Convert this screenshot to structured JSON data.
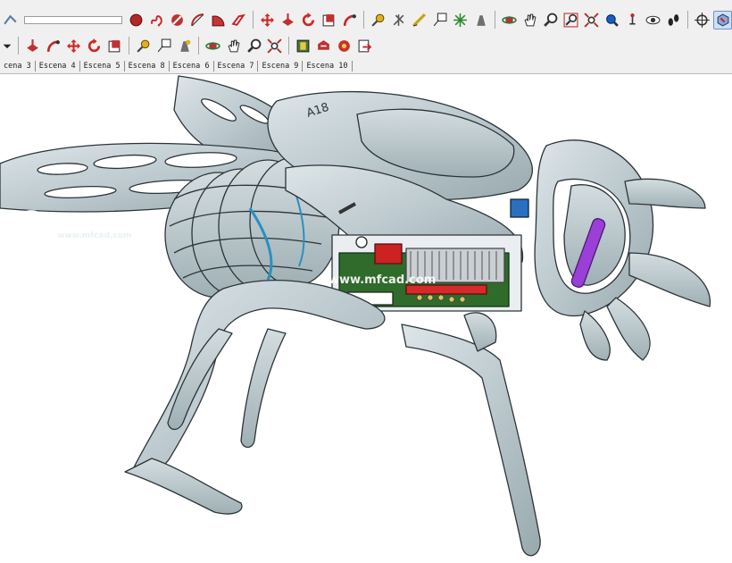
{
  "scene_tabs": [
    "cena 3",
    "Escena 4",
    "Escena 5",
    "Escena 8",
    "Escena 6",
    "Escena 7",
    "Escena 9",
    "Escena 10"
  ],
  "watermark": {
    "brand_cn": "沐风网",
    "url_small": "www.mfcad.com",
    "url_center": "www.mfcad.com"
  },
  "model_label": "A18",
  "toolbar_row1_icons": [
    "partial-icon",
    "circle-icon",
    "freehand-icon",
    "no-icon",
    "protractor-icon",
    "pie-icon",
    "curve-icon",
    "move-icon",
    "push-pull-icon",
    "rotate-icon",
    "scale-icon",
    "follow-me-icon",
    "tape-measure-icon",
    "axes-icon",
    "dimension-icon",
    "text-label-icon",
    "section-icon",
    "paint-icon",
    "orbit-icon",
    "pan-icon",
    "zoom-icon",
    "zoom-window-icon",
    "zoom-extents-icon",
    "previous-view-icon",
    "position-camera-icon",
    "look-around-icon",
    "walk-icon",
    "crosshair-icon",
    "component-icon",
    "component-alt-icon"
  ],
  "toolbar_row2_icons": [
    "dropdown-icon",
    "push-pull-icon",
    "follow-me-icon",
    "move-icon",
    "rotate-icon",
    "scale-icon",
    "tape-measure-icon",
    "text-label-icon",
    "paint-icon",
    "orbit-icon",
    "pan-icon",
    "zoom-icon",
    "zoom-extents-icon",
    "warehouse-icon",
    "share-icon",
    "components-icon",
    "export-icon"
  ],
  "colors": {
    "toolbar_bg": "#f0f0f0",
    "model_metal": "#c4cfd4",
    "model_outline": "#2c3438",
    "pcb_green": "#2f6b2a",
    "purple_rod": "#9a40d8"
  }
}
